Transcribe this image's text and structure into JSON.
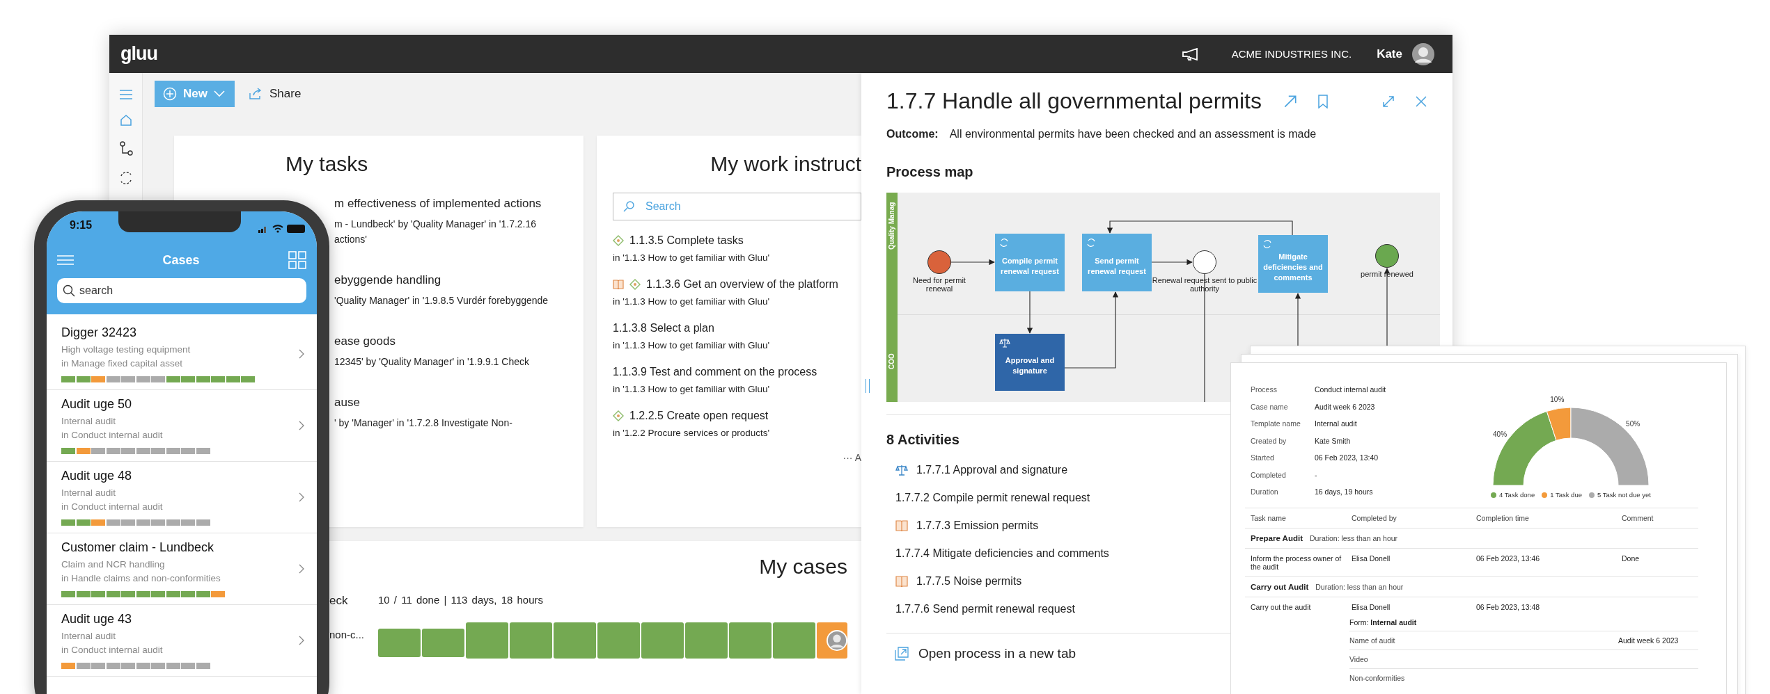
{
  "desktop": {
    "logo": "gluu",
    "company": "ACME INDUSTRIES INC.",
    "user": "Kate",
    "new_button": "New",
    "share_button": "Share",
    "my_tasks": {
      "title": "My tasks",
      "items": [
        {
          "title": "m effectiveness of implemented actions",
          "lines": [
            "m - Lundbeck' by 'Quality Manager' in '1.7.2.16",
            "actions'"
          ]
        },
        {
          "title": "ebyggende handling",
          "lines": [
            "'Quality Manager' in '1.9.8.5 Vurdér forebyggende"
          ]
        },
        {
          "title": "ease goods",
          "lines": [
            "12345' by 'Quality Manager' in '1.9.9.1 Check"
          ]
        },
        {
          "title": "ause",
          "lines": [
            "' by 'Manager' in '1.7.2.8 Investigate Non-"
          ]
        }
      ]
    },
    "work_instructions": {
      "title": "My work instruct",
      "search_placeholder": "Search",
      "items": [
        {
          "kind": "task",
          "title": "1.1.3.5 Complete tasks",
          "sub": "in '1.1.3 How to get familiar with Gluu'"
        },
        {
          "kind": "guidetask",
          "title": "1.1.3.6 Get an overview of the platform",
          "sub": "in '1.1.3 How to get familiar with Gluu'"
        },
        {
          "kind": "plain",
          "title": "1.1.3.8 Select a plan",
          "sub": "in '1.1.3 How to get familiar with Gluu'"
        },
        {
          "kind": "plain",
          "title": "1.1.3.9 Test and comment on the process",
          "sub": "in '1.1.3 How to get familiar with Gluu'"
        },
        {
          "kind": "task",
          "title": "1.2.2.5 Create open request",
          "sub": "in '1.2.2 Procure services or products'"
        }
      ],
      "more_link": "··· A"
    },
    "my_cases": {
      "title": "My cases",
      "name": "eck",
      "process": "non-c...",
      "summary": "10 / 11 done | 113 days, 18 hours",
      "steps": [
        {
          "color": "#74a952"
        },
        {
          "color": "#74a952"
        },
        {
          "color": "#74a952"
        },
        {
          "color": "#74a952"
        },
        {
          "color": "#74a952"
        },
        {
          "color": "#74a952"
        },
        {
          "color": "#74a952"
        },
        {
          "color": "#74a952"
        },
        {
          "color": "#74a952"
        },
        {
          "color": "#74a952"
        },
        {
          "color": "#f39a3b"
        }
      ]
    }
  },
  "panel": {
    "title": "1.7.7 Handle all governmental permits",
    "outcome_label": "Outcome:",
    "outcome": "All environmental permits have been checked and an assessment is made",
    "process_map_heading": "Process map",
    "process_map": {
      "lanes": [
        "Quality Manag",
        "COO"
      ],
      "nodes": [
        {
          "kind": "start",
          "label": "Need for permit renewal"
        },
        {
          "kind": "task",
          "label": "Compile permit renewal request"
        },
        {
          "kind": "task",
          "label": "Send permit renewal request"
        },
        {
          "kind": "event",
          "label": "Renewal request sent to public authority"
        },
        {
          "kind": "task",
          "label": "Mitigate deficiencies and comments"
        },
        {
          "kind": "end",
          "label": "permit renewed"
        },
        {
          "kind": "approval",
          "label": "Approval and signature"
        }
      ]
    },
    "activities_heading": "8 Activities",
    "activities": [
      {
        "kind": "approval",
        "label": "1.7.7.1 Approval and signature"
      },
      {
        "kind": "plain",
        "label": "1.7.7.2 Compile permit renewal request"
      },
      {
        "kind": "guide",
        "label": "1.7.7.3 Emission permits"
      },
      {
        "kind": "plain",
        "label": "1.7.7.4 Mitigate deficiencies and comments"
      },
      {
        "kind": "guide",
        "label": "1.7.7.5 Noise permits"
      },
      {
        "kind": "plain",
        "label": "1.7.7.6 Send permit renewal request"
      }
    ],
    "open_link": "Open process in a new tab"
  },
  "phone": {
    "time": "9:15",
    "title": "Cases",
    "search_placeholder": "search",
    "cases": [
      {
        "title": "Digger 32423",
        "subtitle": "High voltage testing equipment",
        "process": "in Manage fixed capital asset",
        "steps": [
          {
            "color": "#74a952"
          },
          {
            "color": "#74a952"
          },
          {
            "color": "#f39a3b"
          },
          {
            "color": "#ababab"
          },
          {
            "color": "#ababab"
          },
          {
            "color": "#ababab"
          },
          {
            "color": "#ababab"
          },
          {
            "color": "#74a952"
          },
          {
            "color": "#74a952"
          },
          {
            "color": "#74a952"
          },
          {
            "color": "#74a952"
          },
          {
            "color": "#74a952"
          },
          {
            "color": "#74a952"
          }
        ]
      },
      {
        "title": "Audit uge 50",
        "subtitle": "Internal audit",
        "process": "in Conduct internal audit",
        "steps": [
          {
            "color": "#74a952"
          },
          {
            "color": "#f39a3b"
          },
          {
            "color": "#ababab"
          },
          {
            "color": "#ababab"
          },
          {
            "color": "#ababab"
          },
          {
            "color": "#ababab"
          },
          {
            "color": "#ababab"
          },
          {
            "color": "#ababab"
          },
          {
            "color": "#ababab"
          },
          {
            "color": "#ababab"
          }
        ]
      },
      {
        "title": "Audit uge 48",
        "subtitle": "Internal audit",
        "process": "in Conduct internal audit",
        "steps": [
          {
            "color": "#74a952"
          },
          {
            "color": "#74a952"
          },
          {
            "color": "#f39a3b"
          },
          {
            "color": "#ababab"
          },
          {
            "color": "#ababab"
          },
          {
            "color": "#ababab"
          },
          {
            "color": "#ababab"
          },
          {
            "color": "#ababab"
          },
          {
            "color": "#ababab"
          },
          {
            "color": "#ababab"
          }
        ]
      },
      {
        "title": "Customer claim - Lundbeck",
        "subtitle": "Claim and NCR handling",
        "process": "in Handle claims and non-conformities",
        "steps": [
          {
            "color": "#74a952"
          },
          {
            "color": "#74a952"
          },
          {
            "color": "#74a952"
          },
          {
            "color": "#74a952"
          },
          {
            "color": "#74a952"
          },
          {
            "color": "#74a952"
          },
          {
            "color": "#74a952"
          },
          {
            "color": "#74a952"
          },
          {
            "color": "#74a952"
          },
          {
            "color": "#74a952"
          },
          {
            "color": "#f39a3b"
          }
        ]
      },
      {
        "title": "Audit uge 43",
        "subtitle": "Internal audit",
        "process": "in Conduct internal audit",
        "steps": [
          {
            "color": "#f39a3b"
          },
          {
            "color": "#ababab"
          },
          {
            "color": "#ababab"
          },
          {
            "color": "#ababab"
          },
          {
            "color": "#ababab"
          },
          {
            "color": "#ababab"
          },
          {
            "color": "#ababab"
          },
          {
            "color": "#ababab"
          },
          {
            "color": "#ababab"
          },
          {
            "color": "#ababab"
          }
        ]
      }
    ]
  },
  "report": {
    "info": [
      {
        "label": "Process",
        "value": "Conduct internal audit"
      },
      {
        "label": "Case name",
        "value": "Audit week 6 2023"
      },
      {
        "label": "Template name",
        "value": "Internal audit"
      },
      {
        "label": "Created by",
        "value": "Kate Smith"
      },
      {
        "label": "Started",
        "value": "06 Feb 2023, 13:40"
      },
      {
        "label": "Completed",
        "value": "-"
      },
      {
        "label": "Duration",
        "value": "16 days, 19 hours"
      }
    ],
    "chart_data": {
      "type": "donut",
      "categories": [
        "4 Task done",
        "1 Task due",
        "5 Task not due yet"
      ],
      "values": [
        40,
        10,
        50
      ],
      "value_labels": [
        "40%",
        "10%",
        "50%"
      ]
    },
    "legend": [
      {
        "color": "#74a952"
      },
      {
        "color": "#f39a3b"
      },
      {
        "color": "#ababab"
      }
    ],
    "columns": [
      "Task name",
      "Completed by",
      "Completion time",
      "Comment"
    ],
    "groups": [
      {
        "name": "Prepare Audit",
        "duration": "Duration: less than an hour",
        "rows": [
          {
            "task": "Inform the process owner of the audit",
            "by": "Elisa Donell",
            "time": "06 Feb 2023, 13:46",
            "comment": "Done"
          }
        ]
      },
      {
        "name": "Carry out Audit",
        "duration": "Duration: less than an hour",
        "rows": [
          {
            "task": "Carry out the audit",
            "by": "Elisa Donell",
            "time": "06 Feb 2023, 13:48",
            "form": "Form: **Internal audit**",
            "fields": [
              {
                "label": "Name of audit",
                "value": "Audit week 6 2023"
              },
              {
                "label": "Video"
              },
              {
                "label": "Non-conformities"
              }
            ]
          }
        ]
      }
    ]
  }
}
